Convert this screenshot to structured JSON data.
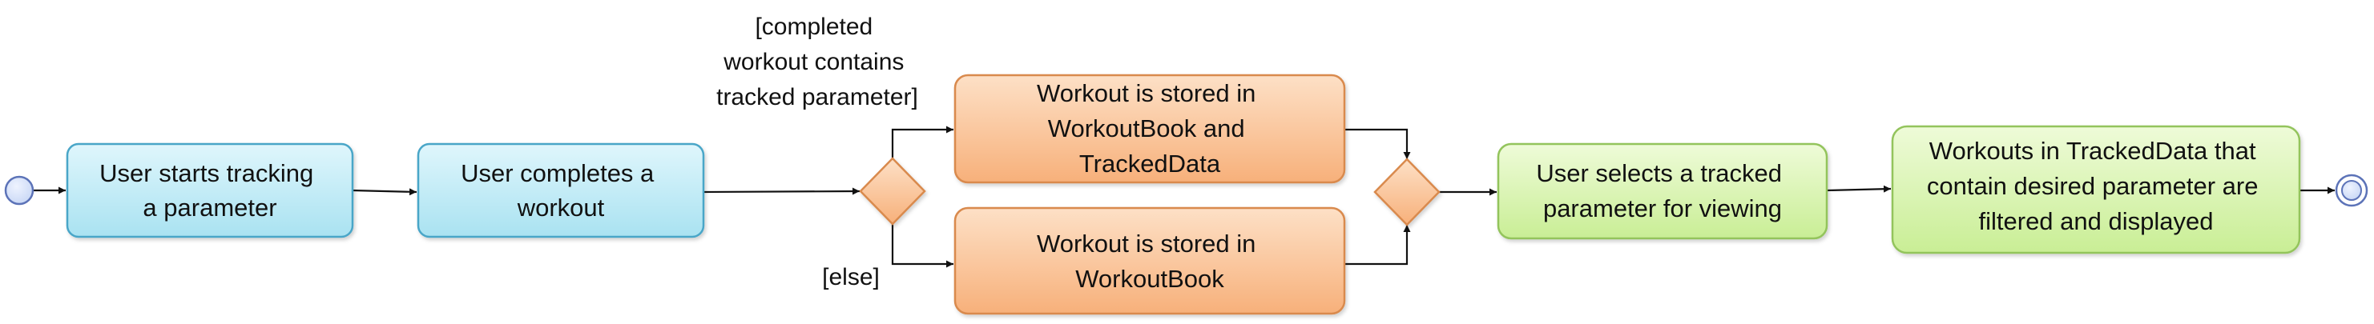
{
  "colors": {
    "blue_fill_top": "#dff6fc",
    "blue_fill_bottom": "#a9e2f1",
    "blue_stroke": "#4aa6c8",
    "orange_fill_top": "#fde0c6",
    "orange_fill_bottom": "#f7b07a",
    "orange_stroke": "#d98a4e",
    "green_fill_top": "#eefbd8",
    "green_fill_bottom": "#c9ee95",
    "green_stroke": "#93c45c",
    "start_fill": "#c8d7f5",
    "start_stroke": "#5c73b8",
    "line": "#111111"
  },
  "nodes": {
    "start_tracking": [
      "User starts tracking",
      "a parameter"
    ],
    "complete_workout": [
      "User completes a",
      "workout"
    ],
    "stored_both": [
      "Workout is stored in",
      "WorkoutBook and",
      "TrackedData"
    ],
    "stored_book": [
      "Workout is stored in",
      "WorkoutBook"
    ],
    "select_param": [
      "User selects a tracked",
      "parameter for viewing"
    ],
    "filtered": [
      "Workouts in TrackedData that",
      "contain desired parameter are",
      "filtered and displayed"
    ]
  },
  "guards": {
    "contains_param": [
      "[completed",
      "workout contains",
      "tracked parameter]"
    ],
    "else": [
      "[else]"
    ]
  }
}
